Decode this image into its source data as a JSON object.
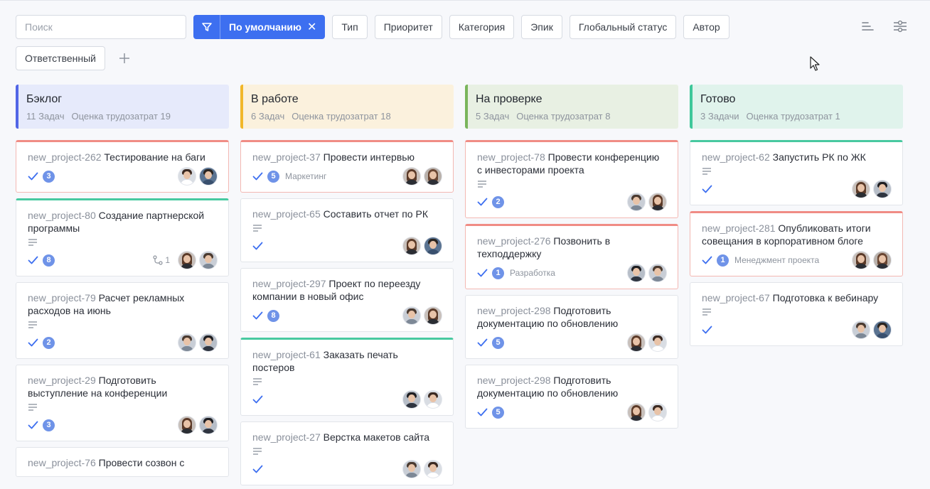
{
  "search": {
    "placeholder": "Поиск"
  },
  "preset": {
    "label": "По умолчанию",
    "clear": "✕"
  },
  "filters": [
    "Тип",
    "Приоритет",
    "Категория",
    "Эпик",
    "Глобальный статус",
    "Автор",
    "Ответственный"
  ],
  "add_filter": "+",
  "colors": {
    "accent": "#3d6ff0",
    "backlog": "#5266e6",
    "inprogress": "#f1b72a",
    "review": "#7ab55c",
    "done": "#3ec79a",
    "badge": "#6f93e8"
  },
  "columns": [
    {
      "title": "Бэклог",
      "count": "11 Задач",
      "estimate": "Оценка трудозатрат 19",
      "color": "#5266e6",
      "bg": "#e6eafb",
      "offset": 78,
      "cards": [
        {
          "id": "new_project-262",
          "title": "Тестирование на баги",
          "desc": false,
          "badge": "3",
          "border": "red",
          "avatars": [
            "m1",
            "m2"
          ]
        },
        {
          "id": "new_project-80",
          "title": "Создание партнерской программы",
          "desc": true,
          "badge": "8",
          "border": "green",
          "link": "1",
          "avatars": [
            "f1",
            "m3"
          ]
        },
        {
          "id": "new_project-79",
          "title": "Расчет рекламных расходов на июнь",
          "desc": true,
          "badge": "2",
          "border": "",
          "avatars": [
            "m3",
            "m4"
          ]
        },
        {
          "id": "new_project-29",
          "title": "Подготовить выступление на конференции",
          "desc": true,
          "badge": "3",
          "border": "",
          "avatars": [
            "f1",
            "m4"
          ]
        },
        {
          "id": "new_project-76",
          "title": "Провести созвон с",
          "desc": false,
          "badge": "",
          "border": "",
          "avatars": []
        }
      ]
    },
    {
      "title": "В работе",
      "count": "6 Задач",
      "estimate": "Оценка трудозатрат 18",
      "color": "#f1b72a",
      "bg": "#fbf1dd",
      "offset": 60,
      "cards": [
        {
          "id": "new_project-37",
          "title": "Провести интервью",
          "desc": false,
          "badge": "5",
          "tag": "Маркетинг",
          "border": "red",
          "avatars": [
            "f1",
            "f2"
          ]
        },
        {
          "id": "new_project-65",
          "title": "Составить отчет по РК",
          "desc": true,
          "badge": "",
          "border": "",
          "avatars": [
            "f1",
            "m2"
          ]
        },
        {
          "id": "new_project-297",
          "title": "Проект по переезду компании в новый офис",
          "desc": false,
          "badge": "8",
          "border": "",
          "avatars": [
            "m3",
            "f1"
          ]
        },
        {
          "id": "new_project-61",
          "title": "Заказать печать постеров",
          "desc": true,
          "badge": "",
          "border": "green",
          "avatars": [
            "m4",
            "m1"
          ]
        },
        {
          "id": "new_project-27",
          "title": "Верстка макетов сайта",
          "desc": true,
          "badge": "",
          "border": "",
          "avatars": [
            "m3",
            "m1"
          ]
        }
      ]
    },
    {
      "title": "На проверке",
      "count": "5 Задач",
      "estimate": "Оценка трудозатрат 8",
      "color": "#7ab55c",
      "bg": "#e8f0e3",
      "offset": 78,
      "cards": [
        {
          "id": "new_project-78",
          "title": "Провести конференцию с инвесторами проекта",
          "desc": true,
          "badge": "2",
          "border": "red",
          "avatars": [
            "m3",
            "f1"
          ]
        },
        {
          "id": "new_project-276",
          "title": "Позвонить в техподдержку",
          "desc": false,
          "badge": "1",
          "tag": "Разработка",
          "border": "red",
          "avatars": [
            "m4",
            "m3"
          ]
        },
        {
          "id": "new_project-298",
          "title": "Подготовить документацию по обновлению",
          "desc": false,
          "badge": "5",
          "border": "",
          "avatars": [
            "f1",
            "m1"
          ]
        },
        {
          "id": "new_project-298",
          "title": "Подготовить документацию по обновлению",
          "desc": false,
          "badge": "5",
          "border": "",
          "avatars": [
            "f1",
            "m1"
          ]
        }
      ]
    },
    {
      "title": "Готово",
      "count": "3 Задачи",
      "estimate": "Оценка трудозатрат 1",
      "color": "#3ec79a",
      "bg": "#e0f3ec",
      "offset": 78,
      "cards": [
        {
          "id": "new_project-62",
          "title": "Запустить РК по ЖК",
          "desc": true,
          "badge": "",
          "border": "green",
          "avatars": [
            "f1",
            "m4"
          ]
        },
        {
          "id": "new_project-281",
          "title": "Опубликовать итоги совещания в корпоративном блоге",
          "desc": false,
          "badge": "1",
          "tag": "Менеджмент проекта",
          "border": "red",
          "avatars": [
            "f1",
            "f2"
          ]
        },
        {
          "id": "new_project-67",
          "title": "Подготовка к вебинару",
          "desc": true,
          "badge": "",
          "border": "",
          "avatars": [
            "m3",
            "m2"
          ]
        }
      ]
    }
  ]
}
